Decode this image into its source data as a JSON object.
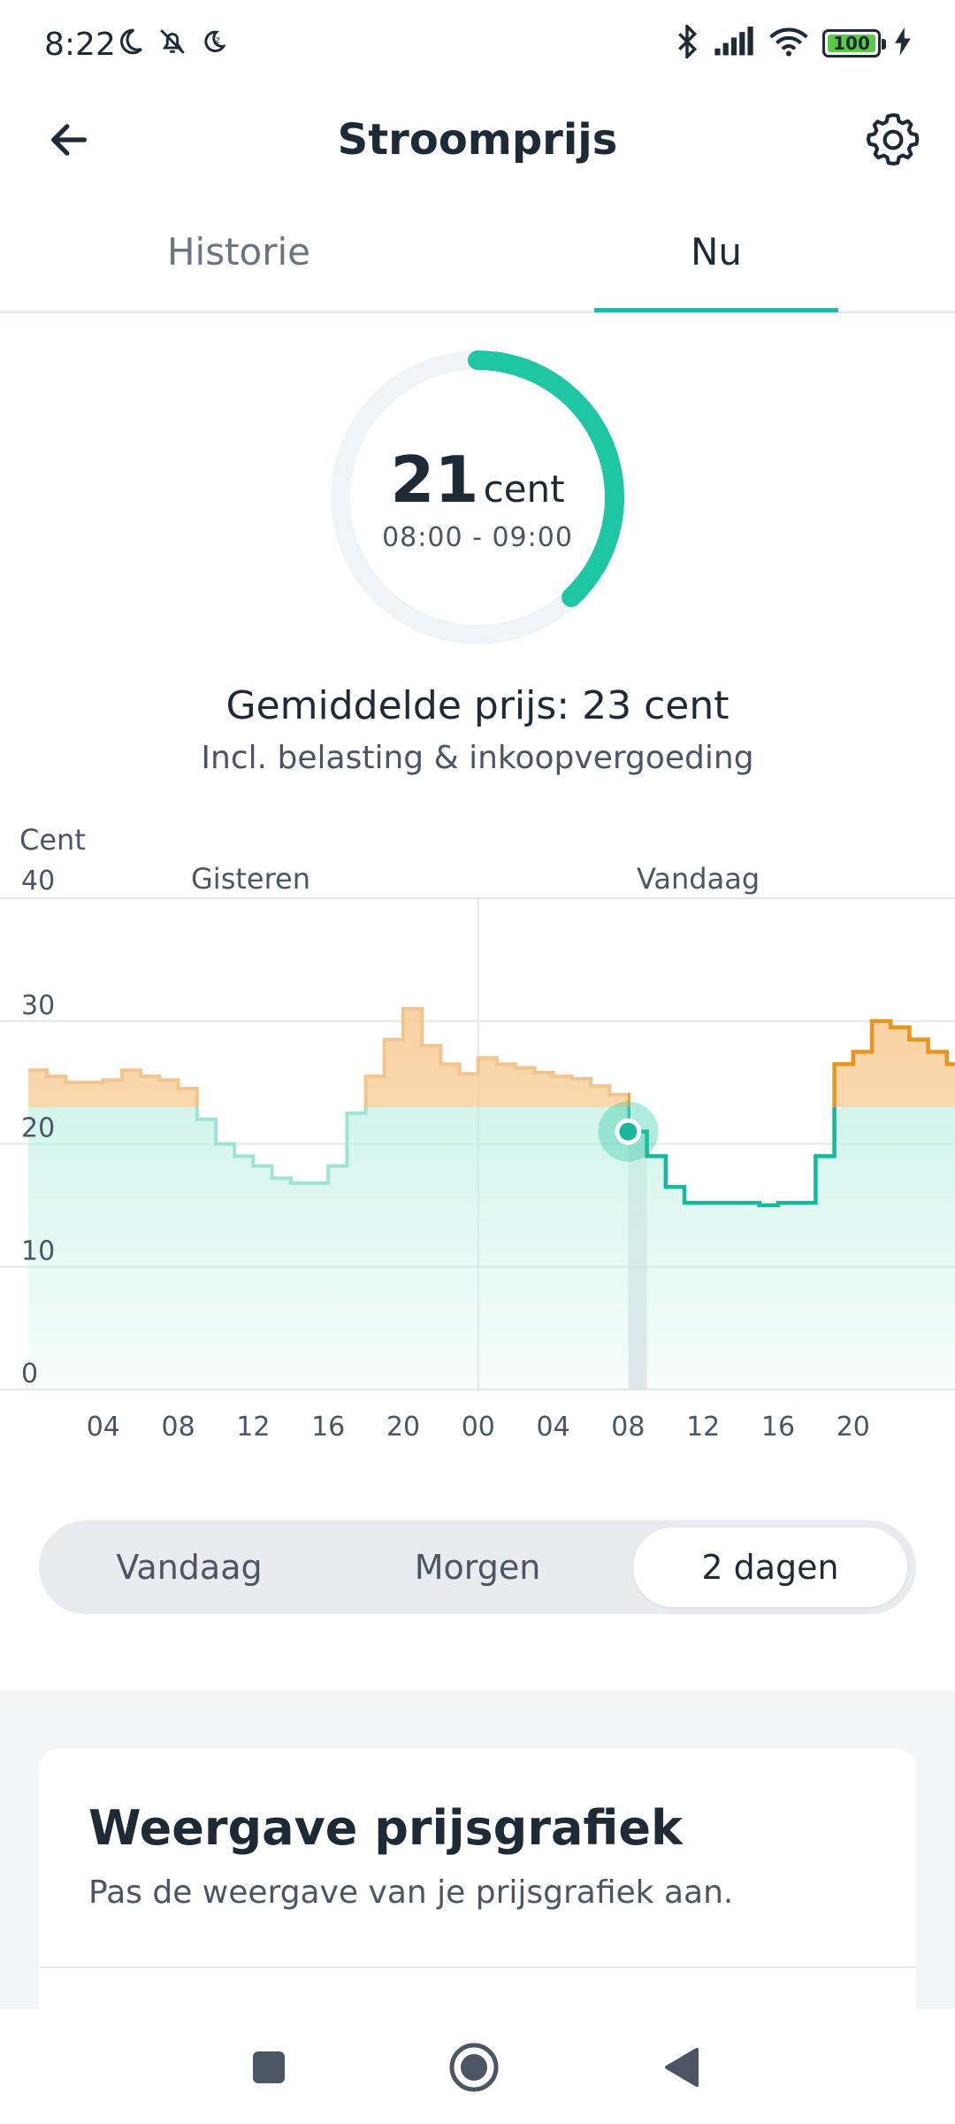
{
  "status_bar": {
    "time": "8:22",
    "battery": "100"
  },
  "app_bar": {
    "title": "Stroomprijs"
  },
  "tabs": [
    {
      "label": "Historie"
    },
    {
      "label": "Nu"
    }
  ],
  "gauge": {
    "value": "21",
    "unit": "cent",
    "time_range": "08:00 - 09:00",
    "progress": 0.38
  },
  "summary": {
    "average": "Gemiddelde prijs: 23 cent",
    "note": "Incl. belasting & inkoopvergoeding"
  },
  "colors": {
    "accent": "#1fc6a4",
    "tab_accent": "#28b4ad",
    "high": "#f0a24c",
    "low": "#7fdcc5"
  },
  "chart_data": {
    "type": "line",
    "step": true,
    "ylabel": "Cent",
    "ylim": [
      0,
      40
    ],
    "yticks": [
      "0",
      "10",
      "20",
      "30",
      "40"
    ],
    "xticks": [
      "04",
      "08",
      "12",
      "16",
      "20",
      "00",
      "04",
      "08",
      "12",
      "16",
      "20"
    ],
    "day_labels": [
      "Gisteren",
      "Vandaag"
    ],
    "average": 23,
    "current_hour_index": 32,
    "series": [
      {
        "values": [
          26,
          25.5,
          25,
          25,
          25.2,
          26,
          25.5,
          25.2,
          24.5,
          22,
          20,
          19,
          18.2,
          17.2,
          16.8,
          16.8,
          18.2,
          22.5,
          25.5,
          28.5,
          31,
          28,
          26.5,
          25.7,
          27,
          26.5,
          26.2,
          25.8,
          25.5,
          25.3,
          24.7,
          24,
          21,
          19,
          16.5,
          15.2,
          15.2,
          15.2,
          15.2,
          15,
          15.2,
          15.2,
          19,
          26.5,
          27.5,
          30,
          29.5,
          28.5,
          27.5,
          26.5
        ]
      }
    ]
  },
  "range_selector": {
    "options": [
      "Vandaag",
      "Morgen",
      "2 dagen"
    ],
    "selected": "2 dagen"
  },
  "card": {
    "title": "Weergave prijsgrafiek",
    "subtitle": "Pas de weergave van je prijsgrafiek aan."
  }
}
